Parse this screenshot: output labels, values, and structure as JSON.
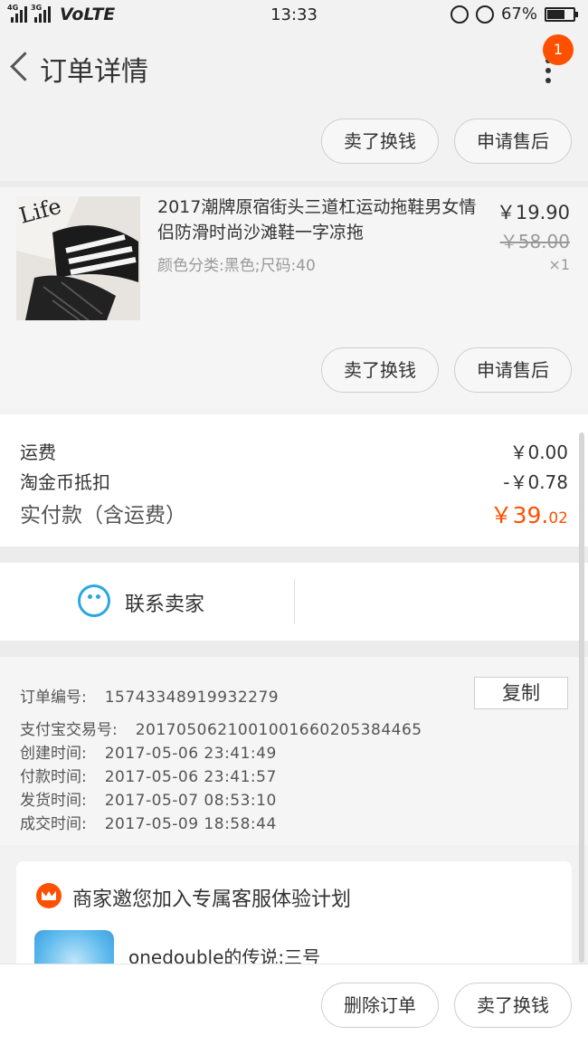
{
  "status_bar": {
    "network_1": "4G",
    "network_2": "3G",
    "volte": "VoLTE",
    "time": "13:33",
    "battery": "67%",
    "battery_level": 0.67
  },
  "nav": {
    "title": "订单详情",
    "badge_count": "1"
  },
  "top_actions": {
    "sell_label": "卖了换钱",
    "aftersale_label": "申请售后"
  },
  "product": {
    "title": "2017潮牌原宿街头三道杠运动拖鞋男女情侣防滑时尚沙滩鞋一字凉拖",
    "sku": "颜色分类:黑色;尺码:40",
    "price": "￥19.90",
    "original_price": "￥58.00",
    "quantity": "×1",
    "thumb_text": "Life",
    "sell_label": "卖了换钱",
    "aftersale_label": "申请售后"
  },
  "fees": {
    "shipping_label": "运费",
    "shipping_value": "￥0.00",
    "coin_label": "淘金币抵扣",
    "coin_value": "-￥0.78",
    "total_label": "实付款（含运费）",
    "total_main": "￥39.",
    "total_cents": "02"
  },
  "contact": {
    "label": "联系卖家"
  },
  "order_info": {
    "copy_label": "复制",
    "rows": [
      {
        "key": "订单编号:",
        "value": "15743348919932279"
      },
      {
        "key": "支付宝交易号:",
        "value": "2017050621001001660205384465"
      },
      {
        "key": "创建时间:",
        "value": "2017-05-06 23:41:49"
      },
      {
        "key": "付款时间:",
        "value": "2017-05-06 23:41:57"
      },
      {
        "key": "发货时间:",
        "value": "2017-05-07 08:53:10"
      },
      {
        "key": "成交时间:",
        "value": "2017-05-09 18:58:44"
      }
    ]
  },
  "service_card": {
    "title": "商家邀您加入专属客服体验计划",
    "name": "onedouble的传说:三号"
  },
  "bottom_bar": {
    "delete_label": "删除订单",
    "sell_label": "卖了换钱"
  },
  "colors": {
    "accent": "#ff5000",
    "contact_blue": "#29a8e0"
  }
}
